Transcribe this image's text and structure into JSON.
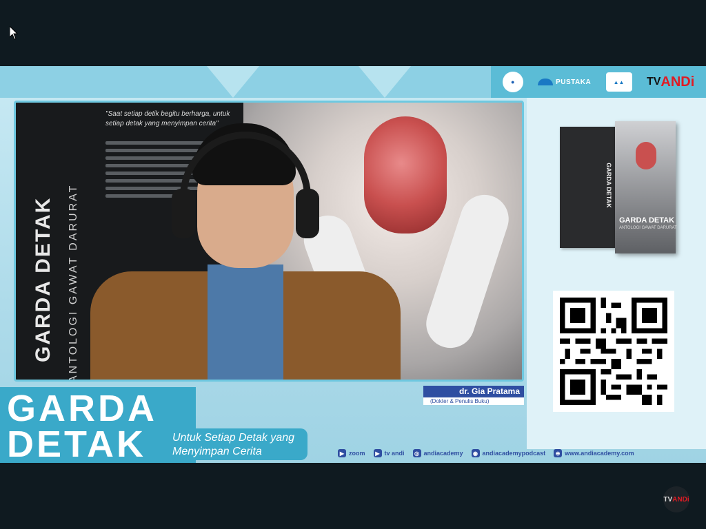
{
  "brand_logos": {
    "kemdik": "",
    "pustaka": "PUSTAKA",
    "akademi": "",
    "tvandi_tv": "TV",
    "tvandi_andi": "ANDi"
  },
  "video": {
    "banner": {
      "title": "GARDA DETAK",
      "subtitle": "ANTOLOGI GAWAT DARURAT",
      "quote": "\"Saat setiap detik begitu berharga, untuk setiap detak yang menyimpan cerita\""
    }
  },
  "speaker": {
    "name": "dr. Gia Pratama",
    "role": "(Dokter & Penulis Buku)"
  },
  "show": {
    "title_line1": "GARDA",
    "title_line2": "DETAK",
    "tagline": "Untuk Setiap Detak yang Menyimpan Cerita"
  },
  "socials": [
    {
      "icon": "zoom-icon",
      "label": "zoom"
    },
    {
      "icon": "tv-icon",
      "label": "tv andi"
    },
    {
      "icon": "instagram-icon",
      "label": "andiacademy"
    },
    {
      "icon": "podcast-icon",
      "label": "andiacademypodcast"
    },
    {
      "icon": "web-icon",
      "label": "www.andiacademy.com"
    }
  ],
  "book": {
    "spine_title": "GARDA DETAK",
    "front_title": "GARDA DETAK",
    "front_subtitle": "ANTOLOGI GAWAT DARURAT"
  },
  "corner_badge": {
    "tv": "TV",
    "andi": "ANDi"
  },
  "colors": {
    "frame_bg": "#0f1a20",
    "stage_bg": "#bfe4f0",
    "accent_blue": "#2f4ea1",
    "accent_cyan": "#3aa9c9",
    "brand_red": "#e01b24"
  }
}
